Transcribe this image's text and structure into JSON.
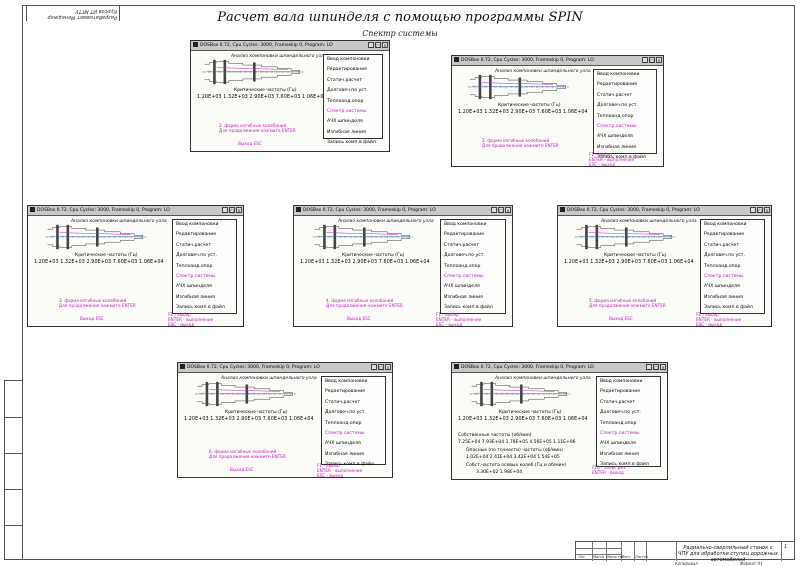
{
  "sheet": {
    "title": "Расчет вала шпинделя с помощью программы SPIN",
    "subtitle": "Спектр системы",
    "stamp": "Разрабатывает Менеджер Курсов ИТ МГТУ",
    "title_block": {
      "name": "Радиально-сверлильный станок с ЧПУ для обработки ступиц дорожных автомобилей",
      "copied": "Копировал",
      "format": "Формат А1",
      "sheet_num": "1",
      "cells": [
        "Лит.",
        "Масса",
        "Масштаб",
        "Лист",
        "Листов"
      ]
    }
  },
  "windows": [
    {
      "title": "DOSBox 0.72, Cpu Cycles:   3000, Frameskip 0, Program:   LO",
      "header": "Анализ компоновки шпиндельного узла",
      "crit_label": "Критические частоты (Гц)",
      "crit_values": "1.20E+03   1.32E+03   2.90E+03   7.60E+03   1.06E+04",
      "note1": "2. форма изгибных колебаний",
      "note2": "Для продолжения нажмите ENTER",
      "esc": "Выход ESC",
      "hint1": "",
      "hint2": "",
      "hint3": ""
    },
    {
      "title": "DOSBox 0.72, Cpu Cycles:   3000, Frameskip 0, Program:   LO",
      "header": "Анализ компоновки шпиндельного узла",
      "crit_label": "Критические частоты (Гц)",
      "crit_values": "1.20E+03   1.32E+03   2.90E+03   7.60E+03   1.06E+04",
      "note1": "2. форма изгибных колебаний",
      "note2": "Для продолжения нажмите ENTER",
      "esc": "",
      "hint1": "F1 - выбор",
      "hint2": "ENTER - выполнение",
      "hint3": "ESC - выход"
    },
    {
      "title": "DOSBox 0.72, Cpu Cycles:   3000, Frameskip 0, Program:   LO",
      "header": "Анализ компоновки шпиндельного узла",
      "crit_label": "Критические частоты (Гц)",
      "crit_values": "1.20E+03   1.32E+03   2.90E+03   7.60E+03   1.06E+04",
      "note1": "3. форма изгибных колебаний",
      "note2": "Для продолжения нажмите ENTER",
      "esc": "Выход ESC",
      "hint1": "F1 - выбор",
      "hint2": "ENTER - выполнение",
      "hint3": "ESC - выход"
    },
    {
      "title": "DOSBox 0.72, Cpu Cycles:   3000, Frameskip 0, Program:   LO",
      "header": "Анализ компоновки шпиндельного узла",
      "crit_label": "Критические частоты (Гц)",
      "crit_values": "1.20E+03   1.32E+03   2.90E+03   7.60E+03   1.06E+04",
      "note1": "4. форма изгибных колебаний",
      "note2": "Для продолжения нажмите ENTER",
      "esc": "Выход ESC",
      "hint1": "F1 - выбор",
      "hint2": "ENTER - выполнение",
      "hint3": "ESC - выход"
    },
    {
      "title": "DOSBox 0.72, Cpu Cycles:   3000, Frameskip 0, Program:   LO",
      "header": "Анализ компоновки шпиндельного узла",
      "crit_label": "Критические частоты (Гц)",
      "crit_values": "1.20E+03   1.32E+03   2.90E+03   7.60E+03   1.06E+04",
      "note1": "5. форма изгибных колебаний",
      "note2": "Для продолжения нажмите ENTER",
      "esc": "Выход ESC",
      "hint1": "F1 - выбор",
      "hint2": "ENTER - выполнение",
      "hint3": "ESC - выход"
    },
    {
      "title": "DOSBox 0.72, Cpu Cycles:   3000, Frameskip 0, Program:   LO",
      "header": "Анализ компоновки шпиндельного узла",
      "crit_label": "Критические частоты (Гц)",
      "crit_values": "1.20E+03   1.32E+03   2.90E+03   7.60E+03   1.06E+04",
      "note1": "6. форма изгибных колебаний",
      "note2": "Для продолжения нажмите ENTER",
      "esc": "Выход ESC",
      "hint1": "F1 - выбор",
      "hint2": "ENTER - выполнение",
      "hint3": "ESC - выход"
    },
    {
      "title": "DOSBox 0.72, Cpu Cycles:   3000, Frameskip 0, Program:   LO",
      "header": "Анализ компоновки шпиндельного узла",
      "crit_label": "Критические частоты (Гц)",
      "crit_values": "1.20E+03   1.32E+03   2.90E+03   7.60E+03   1.06E+04",
      "own_label": "Собственные частоты (об/мин)",
      "own_values": "7.25E+04   7.93E+04   1.78E+05   4.56E+05   1.11E+06",
      "danger_label": "Опасные (по точности) частоты (об/мин)",
      "danger_values": "1.02E+04   2.41E+04   3.42E+04   1.54E+05",
      "axial_label": "Собст.частота осевых колеб.(Гц и об/мин)",
      "axial_values": "3.30E+02   1.98E+04",
      "note1": "",
      "note2": "",
      "esc": "",
      "hint1": "F10 - запис.рез.",
      "hint2": "ENTER - выход",
      "hint3": ""
    }
  ],
  "menu": [
    "Ввод компоновки",
    "Редактирование",
    "Статич.расчет",
    "Долговеч.по уст.",
    "Теплоанд.опор",
    "Спектр системы",
    "АЧХ шпинделя",
    "Изгибная линия",
    "Запись комп.в файл"
  ],
  "menu_selected": "Спектр системы",
  "colors": {
    "accent": "#c020c0",
    "frame": "#555555"
  }
}
